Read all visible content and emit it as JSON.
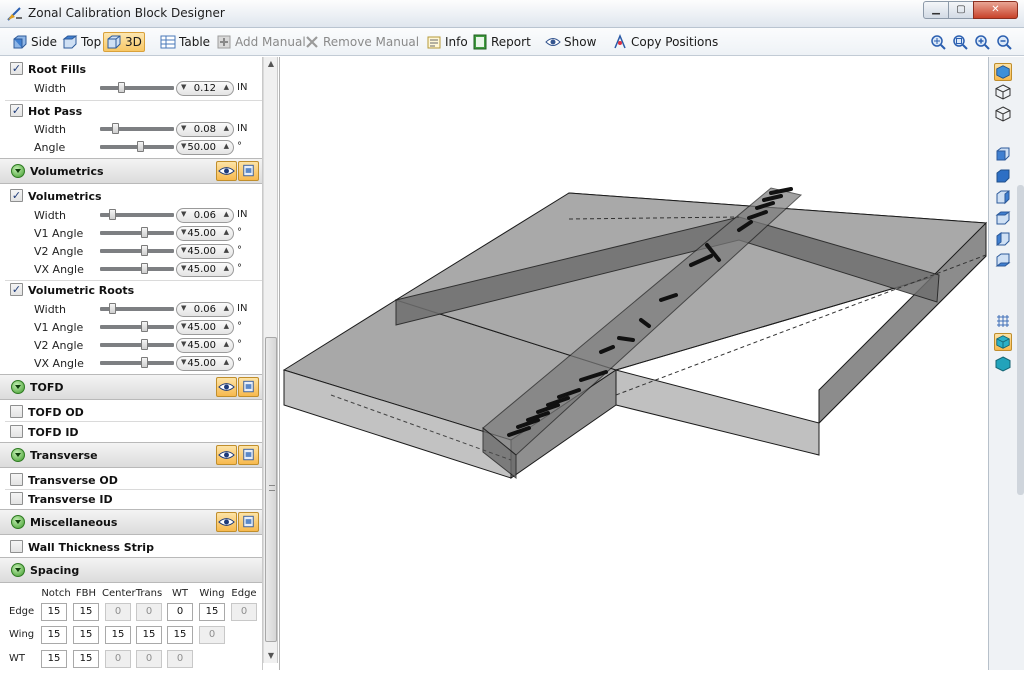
{
  "window": {
    "title": "Zonal Calibration Block Designer"
  },
  "toolbar": {
    "side": "Side",
    "top": "Top",
    "three_d": "3D",
    "table": "Table",
    "add_manual": "Add Manual",
    "remove_manual": "Remove Manual",
    "info": "Info",
    "report": "Report",
    "show": "Show",
    "copy_positions": "Copy Positions"
  },
  "panel": {
    "root_fills": {
      "label": "Root Fills",
      "checked": true,
      "width": {
        "label": "Width",
        "value": "0.12",
        "unit": "IN",
        "level": 0.3
      }
    },
    "hot_pass": {
      "label": "Hot Pass",
      "checked": true,
      "width": {
        "label": "Width",
        "value": "0.08",
        "unit": "IN",
        "level": 0.2
      },
      "angle": {
        "label": "Angle",
        "value": "50.00",
        "unit": "°",
        "level": 0.55
      }
    },
    "volumetrics_section": {
      "title": "Volumetrics"
    },
    "volumetrics": {
      "label": "Volumetrics",
      "checked": true,
      "width": {
        "label": "Width",
        "value": "0.06",
        "unit": "IN",
        "level": 0.15
      },
      "v1": {
        "label": "V1 Angle",
        "value": "45.00",
        "unit": "°",
        "level": 0.62
      },
      "v2": {
        "label": "V2 Angle",
        "value": "45.00",
        "unit": "°",
        "level": 0.62
      },
      "vx": {
        "label": "VX Angle",
        "value": "45.00",
        "unit": "°",
        "level": 0.62
      }
    },
    "volumetric_roots": {
      "label": "Volumetric Roots",
      "checked": true,
      "width": {
        "label": "Width",
        "value": "0.06",
        "unit": "IN",
        "level": 0.15
      },
      "v1": {
        "label": "V1 Angle",
        "value": "45.00",
        "unit": "°",
        "level": 0.62
      },
      "v2": {
        "label": "V2 Angle",
        "value": "45.00",
        "unit": "°",
        "level": 0.62
      },
      "vx": {
        "label": "VX Angle",
        "value": "45.00",
        "unit": "°",
        "level": 0.62
      }
    },
    "tofd_section": {
      "title": "TOFD"
    },
    "tofd_od": {
      "label": "TOFD OD",
      "checked": false
    },
    "tofd_id": {
      "label": "TOFD ID",
      "checked": false
    },
    "transverse_section": {
      "title": "Transverse"
    },
    "transverse_od": {
      "label": "Transverse OD",
      "checked": false
    },
    "transverse_id": {
      "label": "Transverse ID",
      "checked": false
    },
    "misc_section": {
      "title": "Miscellaneous"
    },
    "wall_strip": {
      "label": "Wall Thickness Strip",
      "checked": false
    },
    "spacing_section": {
      "title": "Spacing"
    },
    "spacing": {
      "columns": [
        "Notch",
        "FBH",
        "Center",
        "Trans",
        "WT",
        "Wing",
        "Edge"
      ],
      "rows": [
        {
          "label": "Edge",
          "cells": [
            "15",
            "15",
            "0",
            "0",
            "0",
            "15",
            "0"
          ],
          "disabled": [
            false,
            false,
            true,
            true,
            false,
            false,
            true
          ]
        },
        {
          "label": "Wing",
          "cells": [
            "15",
            "15",
            "15",
            "15",
            "15",
            "0"
          ],
          "disabled": [
            false,
            false,
            false,
            false,
            false,
            true
          ]
        },
        {
          "label": "WT",
          "cells": [
            "15",
            "15",
            "0",
            "0",
            "0"
          ],
          "disabled": [
            false,
            false,
            true,
            true,
            true
          ]
        }
      ]
    }
  },
  "icons": {
    "view_icons": [
      "iso-view-icon",
      "wire-cube-icon",
      "wire-cube-icon",
      "front-view-icon",
      "back-view-icon",
      "left-view-icon",
      "right-view-icon",
      "top-view-icon",
      "bottom-view-icon",
      "grid-icon",
      "shaded-view-icon",
      "solid-view-icon"
    ]
  }
}
